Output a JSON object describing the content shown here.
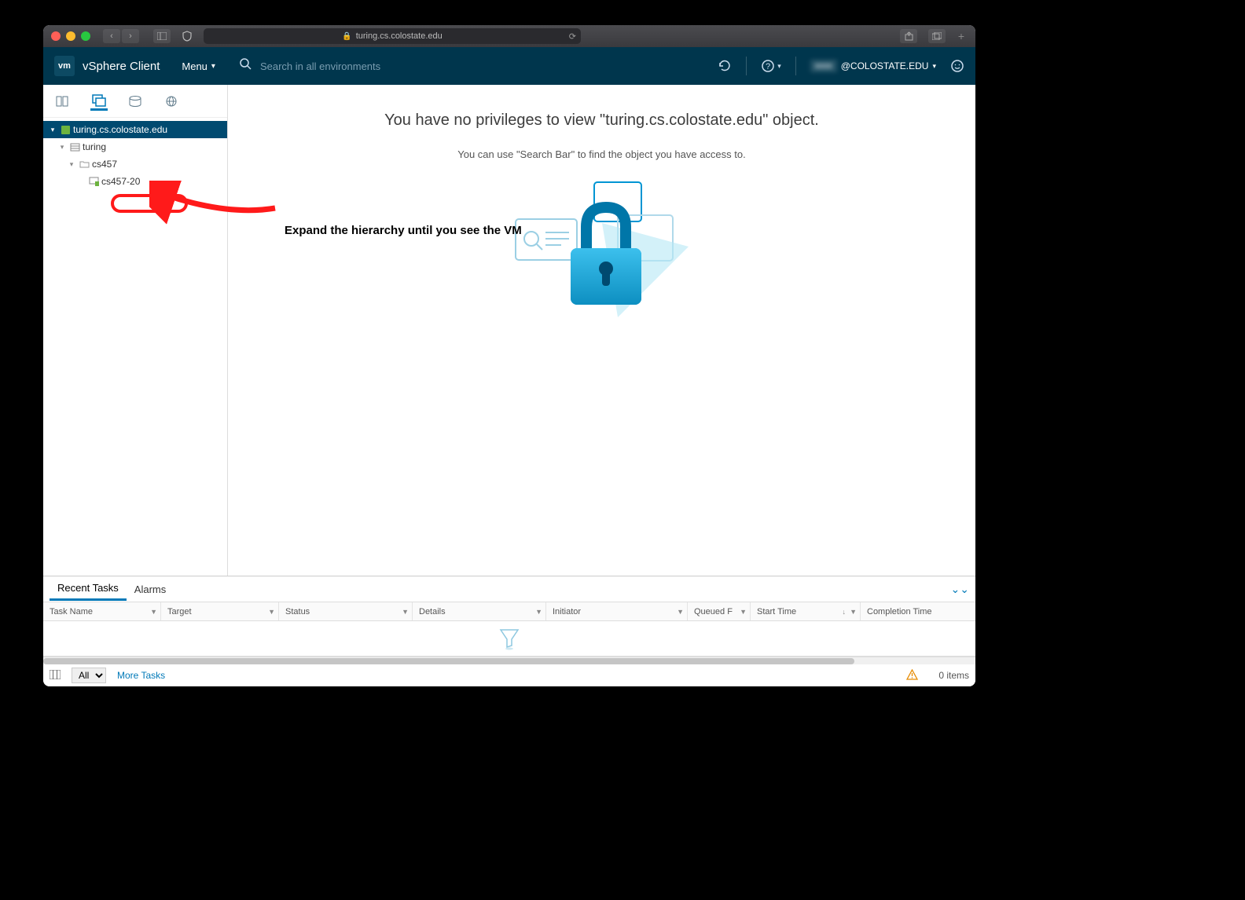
{
  "safari": {
    "url_host": "turing.cs.colostate.edu"
  },
  "header": {
    "logo": "vm",
    "title": "vSphere Client",
    "menu_label": "Menu",
    "search_placeholder": "Search in all environments",
    "user_domain": "@COLOSTATE.EDU"
  },
  "tree": {
    "root": "turing.cs.colostate.edu",
    "level1": "turing",
    "level2": "cs457",
    "vm": "cs457-20"
  },
  "main": {
    "title": "You have no privileges to view \"turing.cs.colostate.edu\" object.",
    "subtitle": "You can use \"Search Bar\" to find the object you have access to."
  },
  "annotation": {
    "text": "Expand the hierarchy until you see the VM"
  },
  "bottom": {
    "tab_recent": "Recent Tasks",
    "tab_alarms": "Alarms",
    "cols": {
      "task_name": "Task Name",
      "target": "Target",
      "status": "Status",
      "details": "Details",
      "initiator": "Initiator",
      "queued": "Queued F",
      "start": "Start Time",
      "completion": "Completion Time"
    },
    "filter_all": "All",
    "more_tasks": "More Tasks",
    "items": "0 items"
  }
}
